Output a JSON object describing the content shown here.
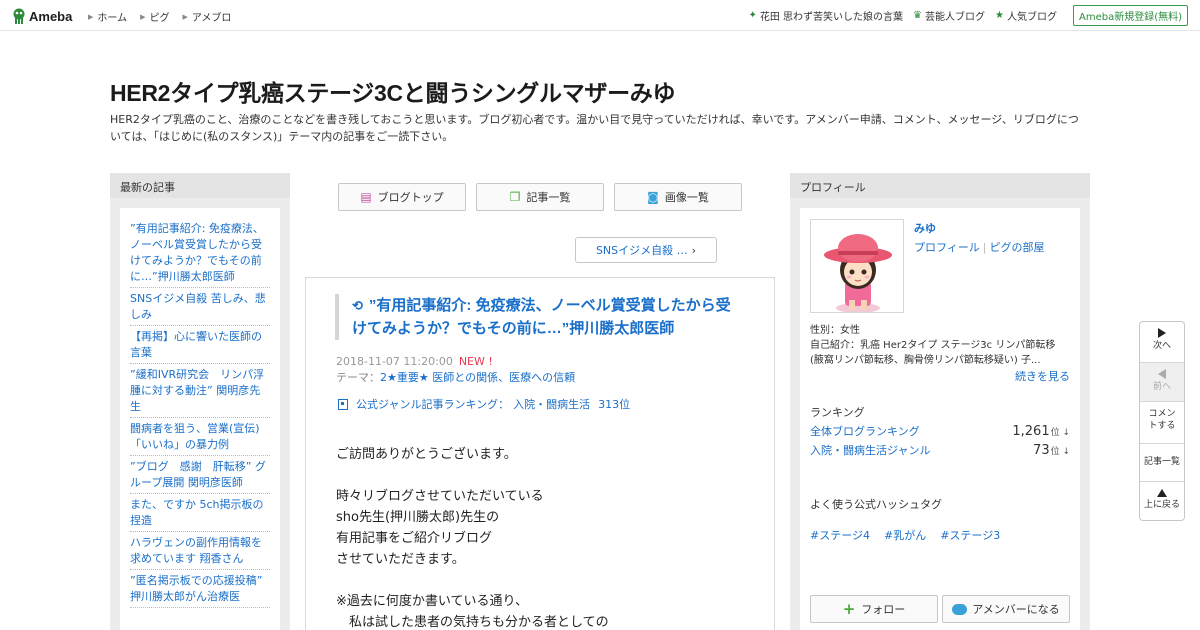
{
  "topbar": {
    "logo_text": "Ameba",
    "nav": [
      "ホーム",
      "ピグ",
      "アメブロ"
    ],
    "right_links": [
      {
        "icon": "sparkle-icon",
        "label": "花田 思わず苦笑いした娘の言葉"
      },
      {
        "icon": "crown-icon",
        "label": "芸能人ブログ"
      },
      {
        "icon": "star-icon",
        "label": "人気ブログ"
      }
    ],
    "signup_label": "Ameba新規登録(無料)"
  },
  "header": {
    "title": "HER2タイプ乳癌ステージ3Cと闘うシングルマザーみゆ",
    "description": "HER2タイプ乳癌のこと、治療のことなどを書き残しておこうと思います。ブログ初心者です。温かい目で見守っていただければ、幸いです。アメンバー申請、コメント、メッセージ、リブログについては、「はじめに(私のスタンス)」テーマ内の記事をご一読下さい。"
  },
  "left": {
    "heading": "最新の記事",
    "items": [
      "”有用記事紹介: 免疫療法、ノーベル賞受賞したから受けてみようか？でもその前に…”押川勝太郎医師",
      "SNSイジメ自殺 苦しみ、悲しみ",
      "【再掲】心に響いた医師の言葉",
      "”緩和IVR研究会　リンパ浮腫に対する動注” 関明彦先生",
      "闘病者を狙う、営業(宣伝)「いいね」の暴力例",
      "”ブログ　感謝　肝転移” グループ展開 関明彦医師",
      "また、ですか 5ch掲示板の捏造",
      "ハラヴェンの副作用情報を求めています 翔香さん",
      "”匿名掲示板での応援投稿” 押川勝太郎がん治療医"
    ]
  },
  "center": {
    "buttons": [
      "ブログトップ",
      "記事一覧",
      "画像一覧"
    ],
    "prev_post": "SNSイジメ自殺 …",
    "article": {
      "title": "”有用記事紹介: 免疫療法、ノーベル賞受賞したから受けてみようか？でもその前に…”押川勝太郎医師",
      "date": "2018-11-07 11:20:00",
      "new_label": "NEW !",
      "theme_label": "テーマ：",
      "theme": "2★重要★ 医師との関係、医療への信頼",
      "ranking_prefix": "公式ジャンル記事ランキング：",
      "ranking_genre": "入院・闘病生活",
      "ranking_rank": "313位",
      "body": "ご訪問ありがとうございます。\n\n時々リブログさせていただいている\nsho先生(押川勝太郎)先生の\n有用記事をご紹介リブログ\nさせていただきます。\n\n※過去に何度か書いている通り、\n　私は試した患者の気持ちも分かる者としての"
    }
  },
  "right": {
    "heading": "プロフィール",
    "name": "みゆ",
    "profile_link": "プロフィール",
    "pigg_link": "ピグの部屋",
    "gender": "性別：女性",
    "intro": "自己紹介：乳癌 Her2タイプ ステージ3c リンパ節転移 (腋窩リンパ節転移、胸骨傍リンパ節転移疑い) 子...",
    "see_more": "続きを見る",
    "ranking_heading": "ランキング",
    "rankings": [
      {
        "label": "全体ブログランキング",
        "value": "1,261",
        "unit": "位 ↓"
      },
      {
        "label": "入院・闘病生活ジャンル",
        "value": "73",
        "unit": "位 ↓"
      }
    ],
    "hashtag_heading": "よく使う公式ハッシュタグ",
    "hashtags": [
      "#ステージ4",
      "#乳がん",
      "#ステージ3"
    ],
    "follow_label": "フォロー",
    "member_label": "アメンバーになる"
  },
  "side_nav": {
    "next": "次へ",
    "prev": "前へ",
    "comment": "コメントする",
    "list": "記事一覧",
    "top": "上に戻る"
  },
  "colors": {
    "link": "#1a6fc9",
    "accent_green": "#2d8c3c",
    "new_red": "#e8384f"
  }
}
